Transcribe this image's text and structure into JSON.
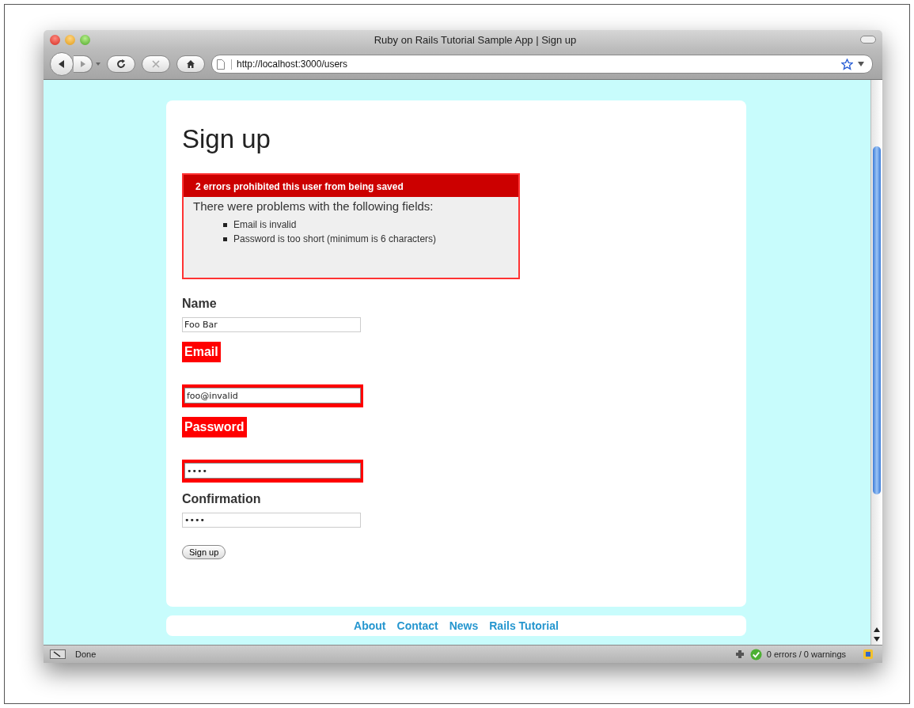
{
  "window": {
    "title": "Ruby on Rails Tutorial Sample App | Sign up"
  },
  "toolbar": {
    "url": "http://localhost:3000/users"
  },
  "page": {
    "heading": "Sign up",
    "error_box": {
      "title": "2 errors prohibited this user from being saved",
      "intro": "There were problems with the following fields:",
      "messages": [
        "Email is invalid",
        "Password is too short (minimum is 6 characters)"
      ]
    },
    "fields": [
      {
        "label": "Name",
        "value": "Foo Bar",
        "error": false
      },
      {
        "label": "Email",
        "value": "foo@invalid",
        "error": true
      },
      {
        "label": "Password",
        "value": "••••",
        "error": true
      },
      {
        "label": "Confirmation",
        "value": "••••",
        "error": false
      }
    ],
    "submit": "Sign up"
  },
  "footer_links": [
    "About",
    "Contact",
    "News",
    "Rails Tutorial"
  ],
  "status_bar": {
    "status": "Done",
    "validator": "0 errors / 0 warnings"
  }
}
